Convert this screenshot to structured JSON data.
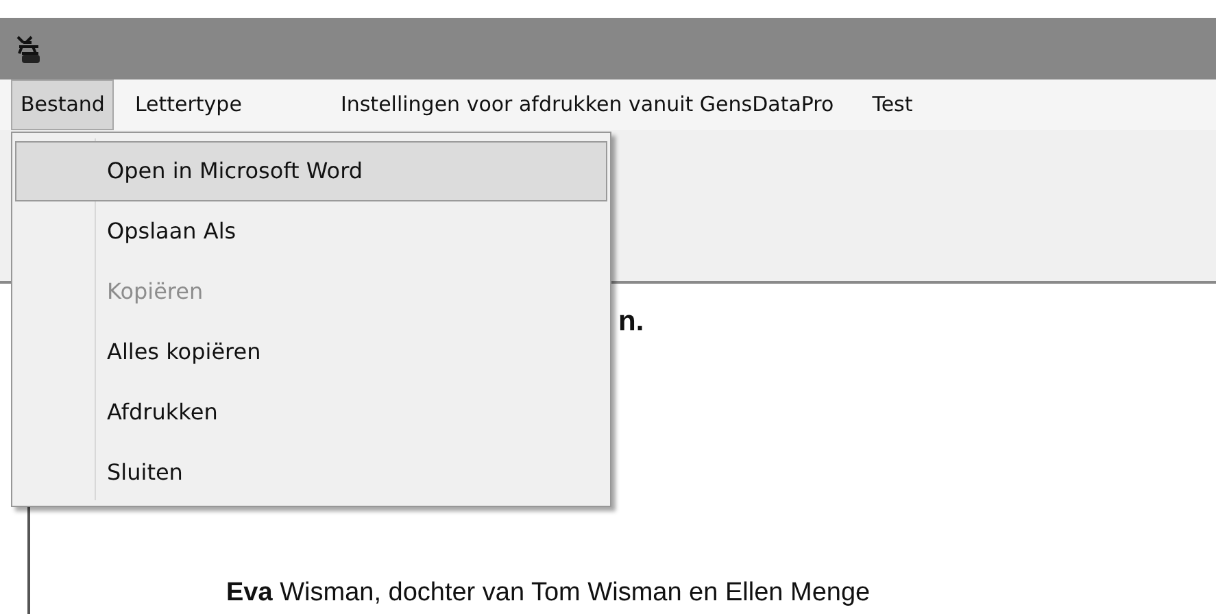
{
  "menu_bar": [
    {
      "label": "Bestand",
      "selected": true
    },
    {
      "label": "Lettertype",
      "selected": false
    },
    {
      "label": "Instellingen voor afdrukken vanuit GensDataPro",
      "selected": false
    },
    {
      "label": "Test",
      "selected": false
    }
  ],
  "dropdown": [
    {
      "label": "Open in Microsoft Word",
      "disabled": false,
      "highlighted": true
    },
    {
      "label": "Opslaan Als",
      "disabled": false,
      "highlighted": false
    },
    {
      "label": "Kopiëren",
      "disabled": true,
      "highlighted": false
    },
    {
      "label": "Alles kopiëren",
      "disabled": false,
      "highlighted": false
    },
    {
      "label": "Afdrukken",
      "disabled": false,
      "highlighted": false
    },
    {
      "label": "Sluiten",
      "disabled": false,
      "highlighted": false
    }
  ],
  "document": {
    "heading": "n.",
    "paragraph": "**Eva** Wisman, dochter van Tom Wisman en Ellen Menge"
  }
}
